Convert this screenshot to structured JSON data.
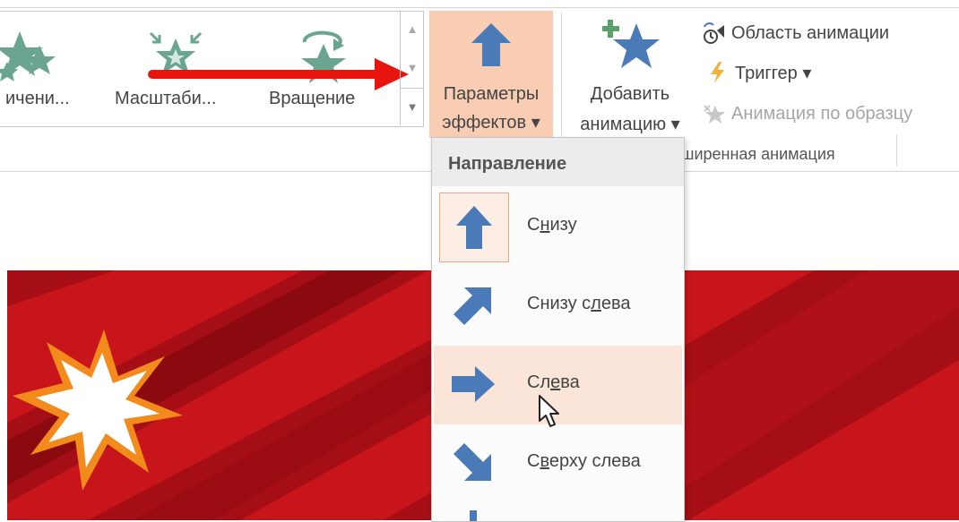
{
  "gallery": {
    "items": [
      {
        "label": "ичени..."
      },
      {
        "label": "Масштаби..."
      },
      {
        "label": "Вращение"
      }
    ]
  },
  "effect_options": {
    "line1": "Параметры",
    "line2": "эффектов ▾"
  },
  "add_animation": {
    "line1": "Добавить",
    "line2": "анимацию ▾"
  },
  "advanced": {
    "animation_pane": "Область анимации",
    "trigger": "Триггер ▾",
    "animation_painter": "Анимация по образцу",
    "group_label": "ширенная анимация"
  },
  "dropdown": {
    "header": "Направление",
    "items": [
      {
        "pre": "С",
        "ul": "н",
        "post": "изу"
      },
      {
        "pre": "Снизу с",
        "ul": "л",
        "post": "ева"
      },
      {
        "pre": "Сл",
        "ul": "е",
        "post": "ва"
      },
      {
        "pre": "С",
        "ul": "в",
        "post": "ерху слева"
      }
    ]
  },
  "colors": {
    "accent_highlight": "#f8cdb4",
    "arrow_blue": "#4a7ab7",
    "star_green": "#6aa58f",
    "slide_red": "#c8141b",
    "annotation_red": "#e8150f"
  }
}
